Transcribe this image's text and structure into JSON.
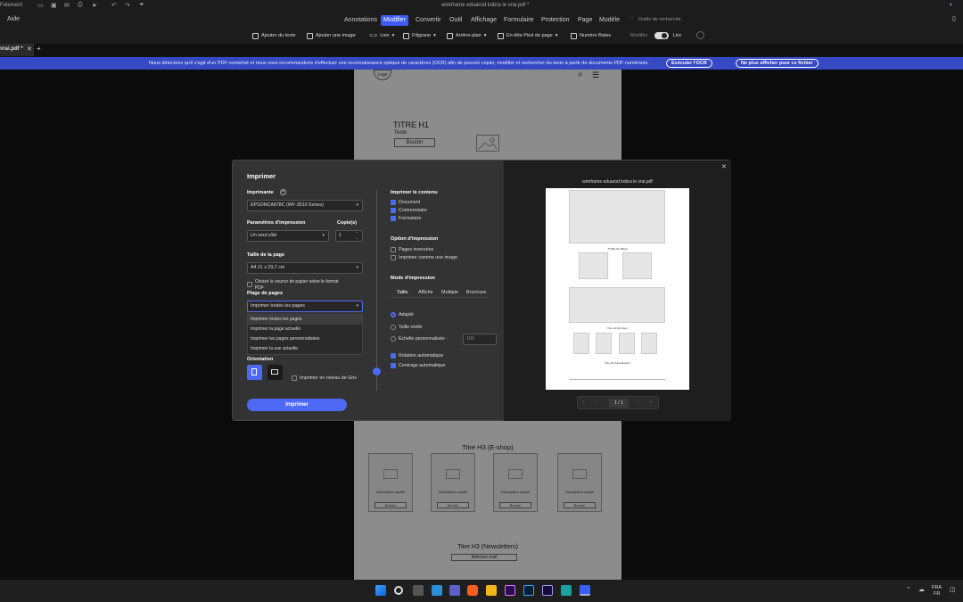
{
  "titlebar": {
    "app_name": "Felement",
    "doc_title": "wireframe eduarod kobra le vrai.pdf *"
  },
  "menubar": {
    "help": "Aide",
    "items": [
      "Annotations",
      "Modifier",
      "Convertir",
      "Outil",
      "Affichage",
      "Formulaire",
      "Protection",
      "Page",
      "Modèle"
    ],
    "active": "Modifier",
    "search_tools": "Outils de recherche"
  },
  "toolbar": {
    "items": [
      "Ajouter du texte",
      "Ajouter une image",
      "Lien",
      "Filigrane",
      "Arrière-plan",
      "En-tête Pied de page",
      "Numéro Bates"
    ],
    "modify_label": "Modifier",
    "read_label": "Lire"
  },
  "tab": {
    "label": "vrai.pdf *"
  },
  "ocr": {
    "message": "Nous détectons qu'il s'agit d'un PDF numérisé et nous vous recommandons d'effectuer une reconnaissance optique de caractères (OCR) afin de pouvoir copier, modifier et rechercher du texte à partir de documents PDF numérisés.",
    "run_button": "Exécuter l'OCR",
    "dismiss_button": "Ne plus afficher pour ce fichier"
  },
  "page_top": {
    "logo": "Logo",
    "title": "TITRE H1",
    "text": "Texte",
    "button": "Bouton"
  },
  "page_bottom": {
    "shop_title": "Titre H3 (E-shop)",
    "products": [
      {
        "desc": "Description rapide",
        "button": "Bouton"
      },
      {
        "desc": "Description rapide",
        "button": "Bouton"
      },
      {
        "desc": "Description rapide",
        "button": "Bouton"
      },
      {
        "desc": "Description rapide",
        "button": "Bouton"
      }
    ],
    "newsletter_title": "Titre H3 (Newsletters)",
    "email_field": "Adresse mail"
  },
  "print_dialog": {
    "title": "Imprimer",
    "printer_label": "Imprimante",
    "printer_value": "EPSONCA878C (WF-3510 Series)",
    "params_label": "Paramètres d'impression",
    "params_value": "Un seul côté",
    "copies_label": "Copie(s)",
    "copies_value": "1",
    "page_size_label": "Taille de la page",
    "page_size_value": "A4 21 x 29,7 cm",
    "paper_source": "Choisir la source de papier selon le format PDF",
    "page_range_label": "Plage de pages",
    "page_range_value": "Imprimer toutes les pages",
    "page_range_options": [
      "Imprimer toutes les pages",
      "Imprimer la page actuelle",
      "Imprimer les pages personnalisées",
      "Imprimer la vue actuelle"
    ],
    "orientation_label": "Orientation",
    "grayscale": "Imprimer en niveau de Gris",
    "print_button": "Imprimer",
    "content_label": "Imprimer le contenu",
    "content_options": [
      "Document",
      "Commentaire",
      "Formulaire"
    ],
    "print_option_label": "Option d'impression",
    "print_options": [
      "Pages inversées",
      "Imprimer comme une image"
    ],
    "mode_label": "Mode d'impression",
    "mode_tabs": [
      "Taille",
      "Affiche",
      "Multiple",
      "Brochure"
    ],
    "size_options": [
      "Adapté",
      "Taille réelle",
      "Échelle personnalisée :"
    ],
    "scale_value": "100",
    "auto_options": [
      "Rotation automatique",
      "Centrage automatique"
    ],
    "preview_title": "wireframe eduarod kobra le vrai.pdf",
    "preview_labels": {
      "blog": "TITRE H3 (Blog)",
      "shop": "Titre H3 (E-shop)",
      "newsletter": "Titre H3 (Newsletters)"
    },
    "page_indicator": "1 / 1"
  },
  "taskbar": {
    "lang_top": "FRA",
    "lang_bottom": "FR"
  },
  "colors": {
    "accent": "#3d5af1",
    "ocr_bar": "#3549c4",
    "dialog_bg": "#333333"
  }
}
